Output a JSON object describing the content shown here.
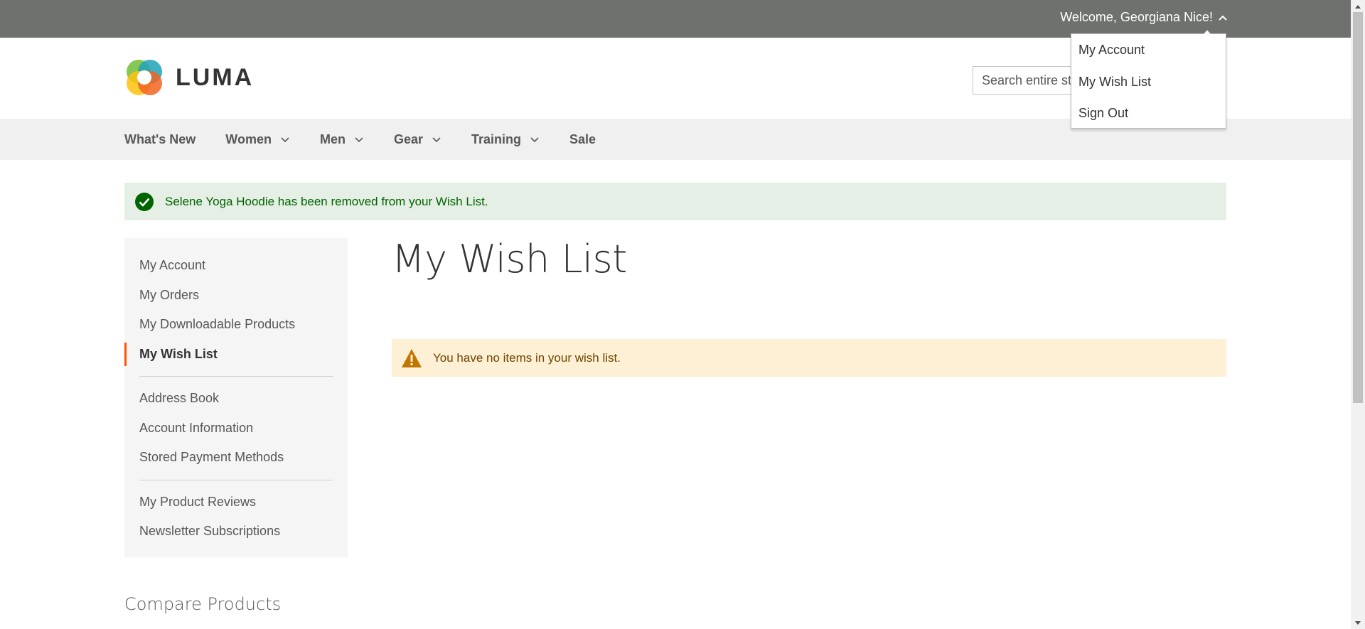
{
  "top_panel": {
    "welcome_text": "Welcome, Georgiana Nice!"
  },
  "account_dropdown": {
    "items": [
      "My Account",
      "My Wish List",
      "Sign Out"
    ]
  },
  "header": {
    "logo_text": "LUMA",
    "search_placeholder": "Search entire store here..."
  },
  "nav": {
    "items": [
      {
        "label": "What's New"
      },
      {
        "label": "Women"
      },
      {
        "label": "Men"
      },
      {
        "label": "Gear"
      },
      {
        "label": "Training"
      },
      {
        "label": "Sale"
      }
    ]
  },
  "messages": {
    "success": "Selene Yoga Hoodie has been removed from your Wish List.",
    "info": "You have no items in your wish list."
  },
  "sidebar": {
    "group1": [
      "My Account",
      "My Orders",
      "My Downloadable Products",
      "My Wish List"
    ],
    "group2": [
      "Address Book",
      "Account Information",
      "Stored Payment Methods"
    ],
    "group3": [
      "My Product Reviews",
      "Newsletter Subscriptions"
    ],
    "active": "My Wish List"
  },
  "main": {
    "page_title": "My Wish List"
  },
  "compare": {
    "title": "Compare Products"
  },
  "colors": {
    "top_panel": "#6e716e",
    "accent": "#ff5501",
    "success_bg": "#e5efe5",
    "info_bg": "#fdf0d5"
  }
}
